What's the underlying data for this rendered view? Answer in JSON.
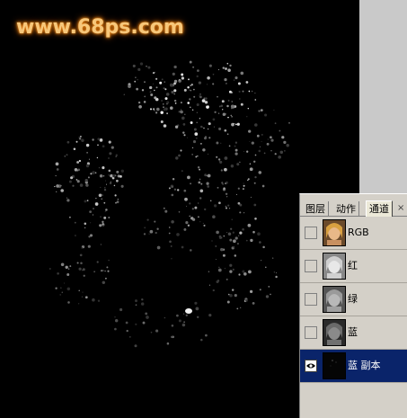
{
  "watermark": "www.68ps.com",
  "panel": {
    "tabs": [
      {
        "label": "图层",
        "active": false
      },
      {
        "label": "动作",
        "active": false
      },
      {
        "label": "通道",
        "active": true
      }
    ],
    "close_icon": "×",
    "channels": [
      {
        "name": "RGB",
        "visible": false,
        "selected": false,
        "thumb": "color-portrait"
      },
      {
        "name": "红",
        "visible": false,
        "selected": false,
        "thumb": "light-gray-portrait"
      },
      {
        "name": "绿",
        "visible": false,
        "selected": false,
        "thumb": "gray-portrait"
      },
      {
        "name": "蓝",
        "visible": false,
        "selected": false,
        "thumb": "dark-gray-portrait"
      },
      {
        "name": "蓝 副本",
        "visible": true,
        "selected": true,
        "thumb": "black-portrait"
      }
    ]
  },
  "colors": {
    "selection": "#0a246a",
    "panel_bg": "#d4d0c8",
    "watermark": "#f7c77a"
  }
}
